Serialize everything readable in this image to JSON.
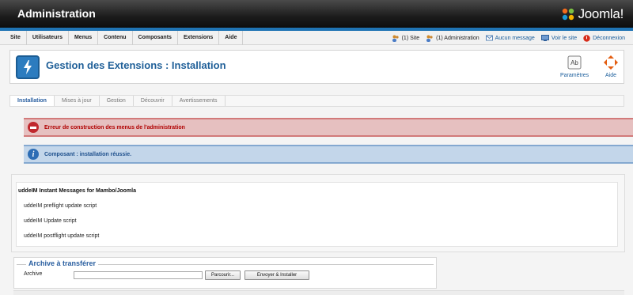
{
  "app": {
    "title": "Administration",
    "logo_text": "Joomla!"
  },
  "colors": {
    "accent": "#1f74b4",
    "title_blue": "#1f5f98",
    "error_red": "#b00000",
    "info_blue": "#1d4f8c"
  },
  "menu": [
    "Site",
    "Utilisateurs",
    "Menus",
    "Contenu",
    "Composants",
    "Extensions",
    "Aide"
  ],
  "status": {
    "site": "(1) Site",
    "admin": "(1) Administration",
    "messages": "Aucun message",
    "view_site": "Voir le site",
    "logout": "Déconnexion"
  },
  "header": {
    "title": "Gestion des Extensions : Installation",
    "title_icon": "lightning-icon",
    "toolbar": {
      "params_label": "Paramètres",
      "help_label": "Aide"
    }
  },
  "subnav": [
    "Installation",
    "Mises à jour",
    "Gestion",
    "Découvrir",
    "Avertissements"
  ],
  "messages": {
    "error": "Erreur de construction des menus de l'administration",
    "info": "Composant : installation réussie."
  },
  "install_output": {
    "title": "uddeIM Instant Messages for Mambo/Joomla",
    "lines": [
      "uddeIM preflight update script",
      "uddeIM Update script",
      "uddeIM postflight update script"
    ]
  },
  "upload": {
    "legend": "Archive à transférer",
    "label": "Archive",
    "file_value": "",
    "browse_label": "Parcourir...",
    "submit_label": "Envoyer & Installer"
  }
}
